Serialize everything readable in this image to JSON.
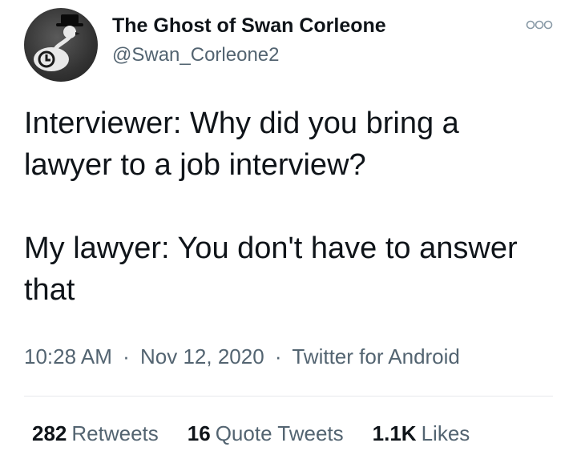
{
  "user": {
    "display_name": "The Ghost of Swan Corleone",
    "handle": "@Swan_Corleone2",
    "avatar_icon": "swan-avatar"
  },
  "tweet": {
    "line1": "Interviewer: Why did you bring a lawyer to a job interview?",
    "line2": "My lawyer: You don't have to answer that"
  },
  "meta": {
    "time": "10:28 AM",
    "separator": "·",
    "date": "Nov 12, 2020",
    "source": "Twitter for Android"
  },
  "stats": {
    "retweets_count": "282",
    "retweets_label": "Retweets",
    "quotes_count": "16",
    "quotes_label": "Quote Tweets",
    "likes_count": "1.1K",
    "likes_label": "Likes"
  },
  "icons": {
    "more": "more-options-icon"
  },
  "colors": {
    "primary_text": "#0f1419",
    "secondary_text": "#536471",
    "divider": "#e6e9ec"
  }
}
